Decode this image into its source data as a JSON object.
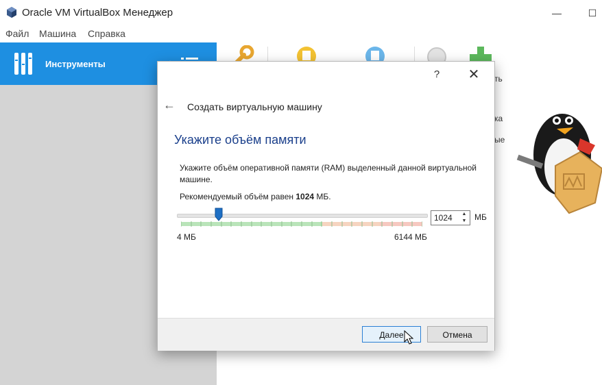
{
  "window": {
    "title": "Oracle VM VirtualBox Менеджер",
    "minimize_glyph": "—",
    "maximize_glyph": "☐"
  },
  "menu": {
    "items": [
      "Файл",
      "Машина",
      "Справка"
    ]
  },
  "sidebar": {
    "tools_label": "Инструменты",
    "tools_icon": "tools-icon",
    "menu_icon": "pin-list-icon",
    "selected_color": "#1e8fe1"
  },
  "toolbar": {
    "icons": [
      "preferences-icon",
      "import-icon",
      "export-icon",
      "extensions-icon",
      "new-vm-icon"
    ]
  },
  "background_fragments": [
    "ть",
    "ка",
    "ые"
  ],
  "dialog": {
    "help_glyph": "?",
    "close_glyph": "✕",
    "back_glyph": "←",
    "title": "Создать виртуальную машину",
    "heading": "Укажите объём памяти",
    "description": "Укажите объём оперативной памяти (RAM) выделенный данной виртуальной машине.",
    "recommended_prefix": "Рекомендуемый объём равен ",
    "recommended_value": "1024",
    "recommended_suffix": " МБ.",
    "memory": {
      "value": "1024",
      "unit": "МБ",
      "min_label": "4 МБ",
      "max_label": "6144 МБ",
      "slider_fraction": 0.167
    },
    "buttons": {
      "next": "Далее",
      "cancel": "Отмена"
    },
    "heading_color": "#1a3f8b"
  }
}
